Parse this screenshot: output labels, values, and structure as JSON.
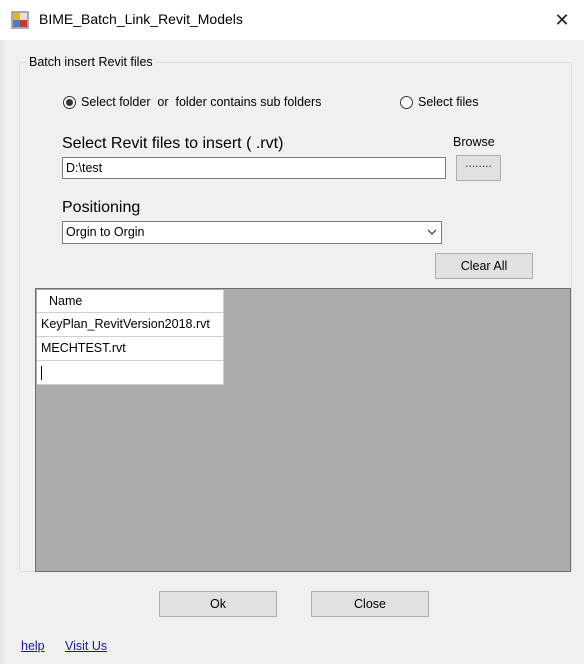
{
  "window": {
    "title": "BIME_Batch_Link_Revit_Models",
    "close_glyph": "✕"
  },
  "group": {
    "title": "Batch insert Revit files"
  },
  "mode": {
    "option_folder_label": "Select folder  or  folder contains sub folders",
    "option_files_label": "Select files",
    "selected": "folder"
  },
  "files": {
    "label": "Select Revit files to insert ( .rvt)",
    "browse_label": "Browse",
    "browse_button_text": "........",
    "path_value": "D:\\test"
  },
  "positioning": {
    "label": "Positioning",
    "selected_option": "Orgin to Orgin"
  },
  "clear_all_label": "Clear All",
  "grid": {
    "column_header": "Name",
    "rows": [
      "KeyPlan_RevitVersion2018.rvt",
      "MECHTEST.rvt"
    ]
  },
  "footer": {
    "ok_label": "Ok",
    "close_label": "Close",
    "help_link": "help",
    "visit_link": "Visit Us"
  },
  "icons": {
    "app": "app-icon",
    "close": "close-icon",
    "dropdown": "chevron-down-icon"
  }
}
